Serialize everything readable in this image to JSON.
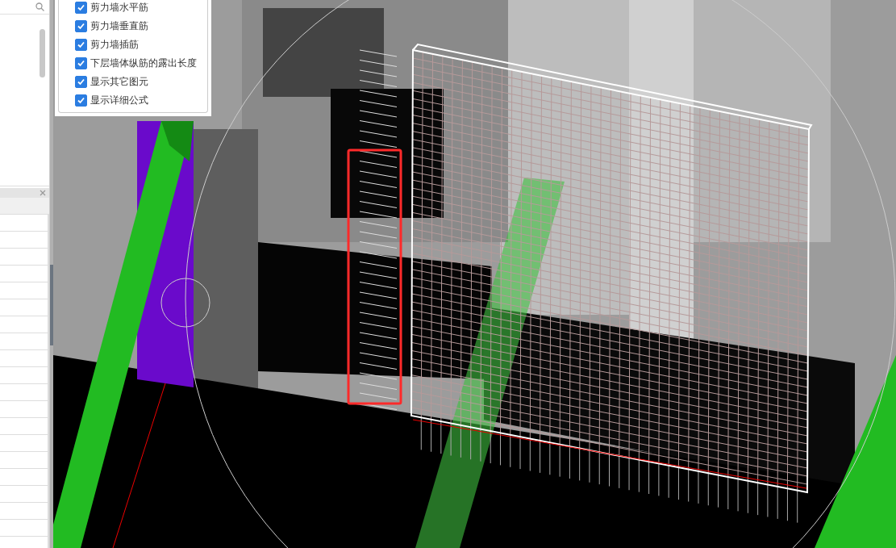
{
  "options_panel": {
    "items": [
      {
        "label": "剪力墙水平筋",
        "checked": true
      },
      {
        "label": "剪力墙垂直筋",
        "checked": true
      },
      {
        "label": "剪力墙插筋",
        "checked": true
      },
      {
        "label": "下层墙体纵筋的露出长度",
        "checked": true
      },
      {
        "label": "显示其它图元",
        "checked": true
      },
      {
        "label": "显示详细公式",
        "checked": true
      }
    ]
  }
}
